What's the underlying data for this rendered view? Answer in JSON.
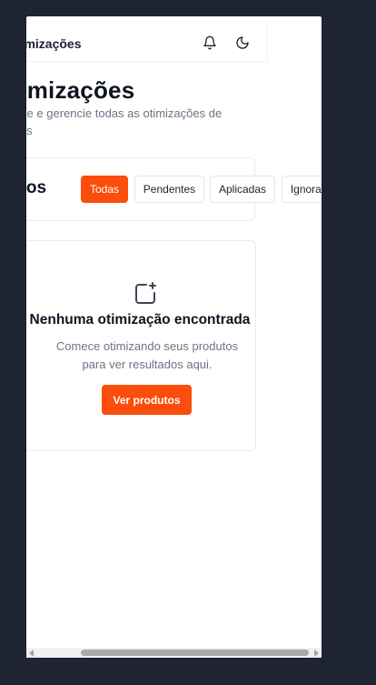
{
  "header": {
    "title": "Otimizações",
    "bell_icon": "bell-icon",
    "theme_icon": "moon-icon"
  },
  "page": {
    "title": "Otimizações",
    "subtitle": "Visualize e gerencie todas as otimizações de produtos"
  },
  "filters": {
    "label": "Filtros",
    "chips": [
      {
        "label": "Todas",
        "active": true
      },
      {
        "label": "Pendentes",
        "active": false
      },
      {
        "label": "Aplicadas",
        "active": false
      },
      {
        "label": "Ignoradas",
        "active": false
      }
    ]
  },
  "empty_state": {
    "icon": "sparkle-square-icon",
    "title": "Nenhuma otimização encontrada",
    "text": "Comece otimizando seus produtos para ver resultados aqui.",
    "cta_label": "Ver produtos"
  },
  "colors": {
    "accent": "#fb4d0b",
    "background": "#1f2433"
  }
}
